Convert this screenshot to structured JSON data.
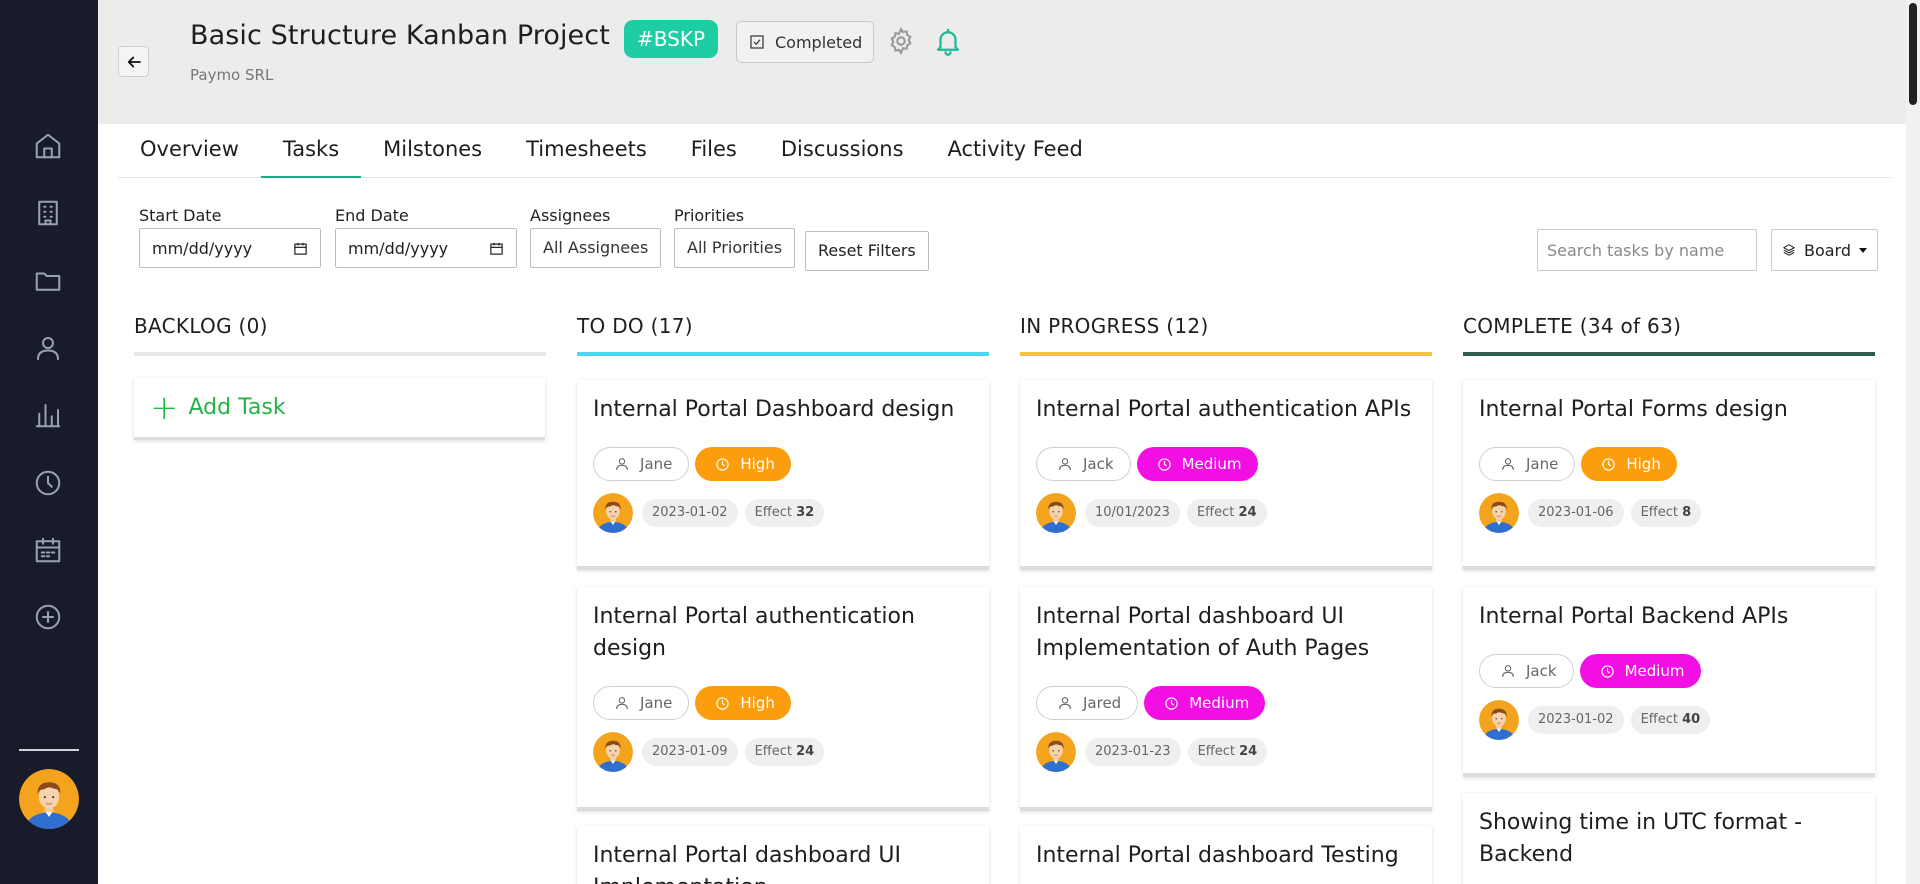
{
  "sidebar": {
    "nav": [
      "home-icon",
      "building-icon",
      "folder-icon",
      "user-icon",
      "bar-chart-icon",
      "clock-icon",
      "calendar-icon",
      "add-circle-icon"
    ]
  },
  "header": {
    "title": "Basic Structure Kanban Project",
    "code": "#BSKP",
    "status_label": "Completed",
    "company": "Paymo SRL"
  },
  "tabs": [
    {
      "label": "Overview",
      "active": false
    },
    {
      "label": "Tasks",
      "active": true
    },
    {
      "label": "Milstones",
      "active": false
    },
    {
      "label": "Timesheets",
      "active": false
    },
    {
      "label": "Files",
      "active": false
    },
    {
      "label": "Discussions",
      "active": false
    },
    {
      "label": "Activity Feed",
      "active": false
    }
  ],
  "filters": {
    "start_label": "Start Date",
    "start_value": "mm/dd/yyyy",
    "end_label": "End Date",
    "end_value": "mm/dd/yyyy",
    "assignees_label": "Assignees",
    "assignees_value": "All Assignees",
    "priorities_label": "Priorities",
    "priorities_value": "All Priorities",
    "reset_label": "Reset Filters",
    "search_placeholder": "Search tasks by name",
    "view_label": "Board"
  },
  "colors": {
    "accent": "#1fcda4",
    "todo": "#4fd6f5",
    "in_progress": "#f2c53d",
    "complete": "#2f5e4a",
    "backlog": "#e8e8e8",
    "high": "#fb9d0c",
    "medium": "#f20fe4",
    "add_task": "#21b546"
  },
  "columns": {
    "backlog": {
      "title": "BACKLOG (0)",
      "add_label": "Add Task"
    },
    "todo": {
      "title": "TO DO (17)",
      "cards": [
        {
          "title": "Internal Portal Dashboard design",
          "assignee": "Jane",
          "priority": "High",
          "date": "2023-01-02",
          "effect_label": "Effect",
          "effect": "32"
        },
        {
          "title": "Internal Portal authentication design",
          "assignee": "Jane",
          "priority": "High",
          "date": "2023-01-09",
          "effect_label": "Effect",
          "effect": "24"
        },
        {
          "title": "Internal Portal dashboard UI Implementation"
        }
      ]
    },
    "in_progress": {
      "title": "IN PROGRESS (12)",
      "cards": [
        {
          "title": "Internal Portal authentication APIs",
          "assignee": "Jack",
          "priority": "Medium",
          "date": "10/01/2023",
          "effect_label": "Effect",
          "effect": "24"
        },
        {
          "title": "Internal Portal dashboard UI Implementation of Auth Pages",
          "assignee": "Jared",
          "priority": "Medium",
          "date": "2023-01-23",
          "effect_label": "Effect",
          "effect": "24"
        },
        {
          "title": "Internal Portal dashboard Testing"
        }
      ]
    },
    "complete": {
      "title": "COMPLETE (34 of 63)",
      "cards": [
        {
          "title": "Internal Portal Forms design",
          "assignee": "Jane",
          "priority": "High",
          "date": "2023-01-06",
          "effect_label": "Effect",
          "effect": "8"
        },
        {
          "title": "Internal Portal Backend APIs",
          "assignee": "Jack",
          "priority": "Medium",
          "date": "2023-01-02",
          "effect_label": "Effect",
          "effect": "40"
        },
        {
          "title": "Showing time in UTC format - Backend"
        }
      ]
    }
  }
}
